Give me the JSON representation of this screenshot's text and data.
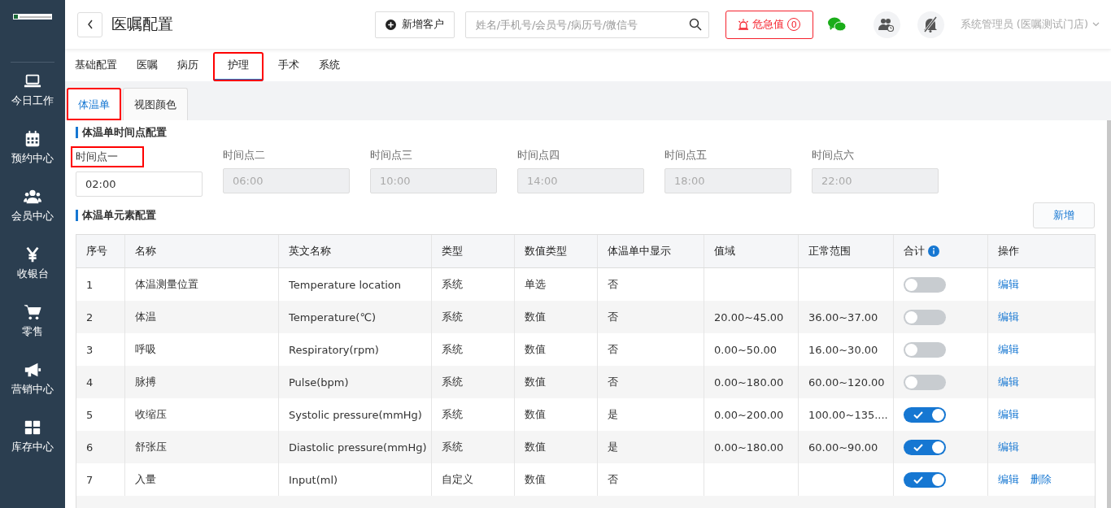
{
  "sidebar": {
    "items": [
      {
        "label": "今日工作"
      },
      {
        "label": "预约中心"
      },
      {
        "label": "会员中心"
      },
      {
        "label": "收银台"
      },
      {
        "label": "零售"
      },
      {
        "label": "营销中心"
      },
      {
        "label": "库存中心"
      }
    ]
  },
  "header": {
    "title": "医嘱配置",
    "new_customer": "新增客户",
    "search": {
      "placeholder": "姓名/手机号/会员号/病历号/微信号"
    },
    "alert": {
      "label": "危急值",
      "count": "0"
    },
    "user": "系统管理员 (医嘱测试门店)"
  },
  "tabs": [
    {
      "label": "基础配置",
      "selected": false,
      "highlighted": false
    },
    {
      "label": "医嘱",
      "selected": false,
      "highlighted": false
    },
    {
      "label": "病历",
      "selected": false,
      "highlighted": false
    },
    {
      "label": "护理",
      "selected": true,
      "highlighted": true
    },
    {
      "label": "手术",
      "selected": false,
      "highlighted": false
    },
    {
      "label": "系统",
      "selected": false,
      "highlighted": false
    }
  ],
  "subtabs": [
    {
      "label": "体温单",
      "selected": true,
      "highlighted": true
    },
    {
      "label": "视图颜色",
      "selected": false,
      "highlighted": false
    }
  ],
  "time_section": {
    "title": "体温单时间点配置",
    "points": [
      {
        "label": "时间点一",
        "value": "02:00",
        "disabled": false,
        "highlighted": true
      },
      {
        "label": "时间点二",
        "value": "06:00",
        "disabled": true,
        "highlighted": false
      },
      {
        "label": "时间点三",
        "value": "10:00",
        "disabled": true,
        "highlighted": false
      },
      {
        "label": "时间点四",
        "value": "14:00",
        "disabled": true,
        "highlighted": false
      },
      {
        "label": "时间点五",
        "value": "18:00",
        "disabled": true,
        "highlighted": false
      },
      {
        "label": "时间点六",
        "value": "22:00",
        "disabled": true,
        "highlighted": false
      }
    ]
  },
  "element_section": {
    "title": "体温单元素配置",
    "add_button": "新增"
  },
  "table": {
    "columns": [
      "序号",
      "名称",
      "英文名称",
      "类型",
      "数值类型",
      "体温单中显示",
      "值域",
      "正常范围",
      "合计",
      "操作"
    ],
    "rows": [
      {
        "cells": [
          "1",
          "体温测量位置",
          "Temperature location",
          "系统",
          "单选",
          "否",
          "",
          ""
        ],
        "total": false,
        "actions": [
          "编辑"
        ]
      },
      {
        "cells": [
          "2",
          "体温",
          "Temperature(℃)",
          "系统",
          "数值",
          "否",
          "20.00~45.00",
          "36.00~37.00"
        ],
        "total": false,
        "actions": [
          "编辑"
        ]
      },
      {
        "cells": [
          "3",
          "呼吸",
          "Respiratory(rpm)",
          "系统",
          "数值",
          "否",
          "0.00~50.00",
          "16.00~30.00"
        ],
        "total": false,
        "actions": [
          "编辑"
        ]
      },
      {
        "cells": [
          "4",
          "脉搏",
          "Pulse(bpm)",
          "系统",
          "数值",
          "否",
          "0.00~180.00",
          "60.00~120.00"
        ],
        "total": false,
        "actions": [
          "编辑"
        ]
      },
      {
        "cells": [
          "5",
          "收缩压",
          "Systolic pressure(mmHg)",
          "系统",
          "数值",
          "是",
          "0.00~200.00",
          "100.00~135...."
        ],
        "total": true,
        "actions": [
          "编辑"
        ]
      },
      {
        "cells": [
          "6",
          "舒张压",
          "Diastolic pressure(mmHg)",
          "系统",
          "数值",
          "是",
          "0.00~180.00",
          "60.00~90.00"
        ],
        "total": true,
        "actions": [
          "编辑"
        ]
      },
      {
        "cells": [
          "7",
          "入量",
          "Input(ml)",
          "自定义",
          "数值",
          "否",
          "",
          ""
        ],
        "total": true,
        "actions": [
          "编辑",
          "删除"
        ]
      }
    ]
  }
}
